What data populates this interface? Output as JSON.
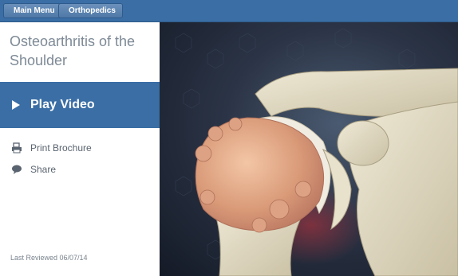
{
  "breadcrumb": {
    "items": [
      {
        "label": "Main Menu"
      },
      {
        "label": "Orthopedics"
      }
    ]
  },
  "sidebar": {
    "title": "Osteoarthritis of the Shoulder",
    "play_label": "Play Video",
    "actions": [
      {
        "label": "Print Brochure",
        "icon": "printer-icon"
      },
      {
        "label": "Share",
        "icon": "speech-bubble-icon"
      }
    ],
    "last_reviewed": "Last Reviewed 06/07/14"
  },
  "colors": {
    "accent": "#3a6ea5",
    "title_text": "#7e8a96",
    "bone": "#e7e0c8",
    "arthritic_bone": "#d9a584"
  }
}
